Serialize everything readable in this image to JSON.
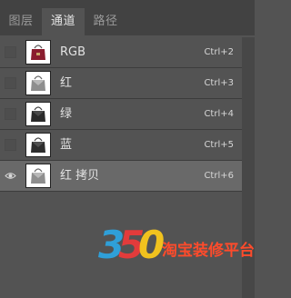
{
  "tabs": [
    {
      "label": "图层",
      "active": false
    },
    {
      "label": "通道",
      "active": true
    },
    {
      "label": "路径",
      "active": false
    }
  ],
  "channels": [
    {
      "name": "RGB",
      "shortcut": "Ctrl+2",
      "visible": false,
      "selected": false,
      "thumb": "color"
    },
    {
      "name": "红",
      "shortcut": "Ctrl+3",
      "visible": false,
      "selected": false,
      "thumb": "light"
    },
    {
      "name": "绿",
      "shortcut": "Ctrl+4",
      "visible": false,
      "selected": false,
      "thumb": "dark"
    },
    {
      "name": "蓝",
      "shortcut": "Ctrl+5",
      "visible": false,
      "selected": false,
      "thumb": "dark"
    },
    {
      "name": "红 拷贝",
      "shortcut": "Ctrl+6",
      "visible": true,
      "selected": true,
      "thumb": "light"
    }
  ],
  "watermark": {
    "digits": [
      "3",
      "5",
      "0"
    ],
    "text": "淘宝装修平台"
  },
  "colors": {
    "panel_bg": "#535353",
    "tabbar_bg": "#424242",
    "selected_row": "#696969",
    "watermark_blue": "#2f9fd8",
    "watermark_red": "#e23b3b",
    "watermark_yellow": "#f1c21e",
    "watermark_text": "#ff4b2b"
  },
  "icons": {
    "visibility": "eye-icon",
    "thumbnail": "handbag-thumbnail-icon"
  }
}
